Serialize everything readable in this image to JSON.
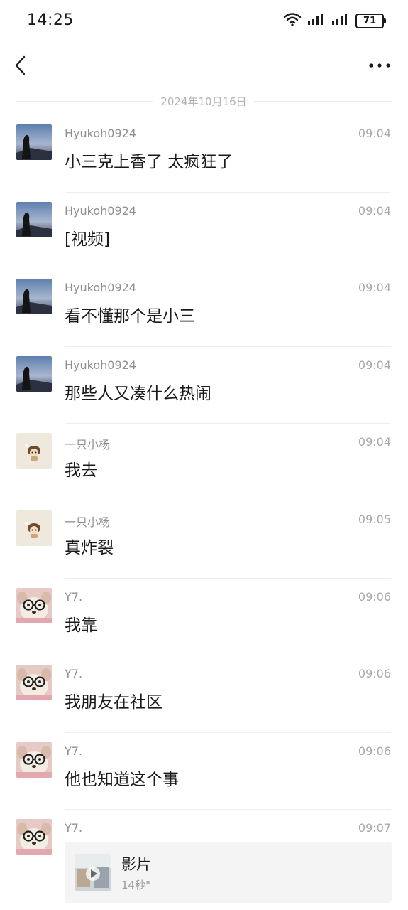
{
  "status_bar": {
    "time": "14:25",
    "battery": "71",
    "icons": [
      "wifi-icon",
      "signal-icon",
      "signal-icon",
      "battery-icon"
    ]
  },
  "nav": {
    "back_icon": "chevron-left-icon",
    "more_icon": "more-horizontal-icon"
  },
  "date_divider": "2024年10月16日",
  "messages": [
    {
      "sender": "Hyukoh0924",
      "time": "09:04",
      "text": "小三克上香了 太疯狂了",
      "avatar": "silhouette"
    },
    {
      "sender": "Hyukoh0924",
      "time": "09:04",
      "text": "[视频]",
      "avatar": "silhouette"
    },
    {
      "sender": "Hyukoh0924",
      "time": "09:04",
      "text": "看不懂那个是小三",
      "avatar": "silhouette"
    },
    {
      "sender": "Hyukoh0924",
      "time": "09:04",
      "text": "那些人又凑什么热闹",
      "avatar": "silhouette"
    },
    {
      "sender": "一只小杨",
      "time": "09:04",
      "text": "我去",
      "avatar": "cartoon"
    },
    {
      "sender": "一只小杨",
      "time": "09:05",
      "text": "真炸裂",
      "avatar": "cartoon"
    },
    {
      "sender": "Y7.",
      "time": "09:06",
      "text": "我靠",
      "avatar": "dog"
    },
    {
      "sender": "Y7.",
      "time": "09:06",
      "text": "我朋友在社区",
      "avatar": "dog"
    },
    {
      "sender": "Y7.",
      "time": "09:06",
      "text": "他也知道这个事",
      "avatar": "dog"
    },
    {
      "sender": "Y7.",
      "time": "09:07",
      "text": "",
      "avatar": "dog"
    }
  ],
  "video_card": {
    "title": "影片",
    "duration": "14秒\"",
    "icon": "play-icon"
  }
}
